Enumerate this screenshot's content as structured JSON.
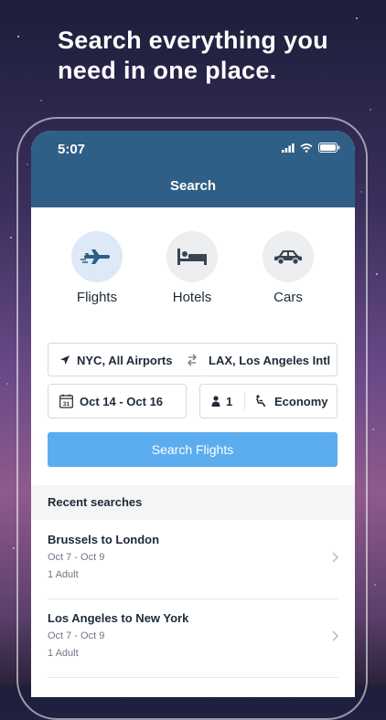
{
  "headline": "Search everything you need in one place.",
  "status": {
    "time": "5:07"
  },
  "nav": {
    "title": "Search"
  },
  "categories": [
    {
      "label": "Flights",
      "icon": "plane-icon",
      "active": true
    },
    {
      "label": "Hotels",
      "icon": "bed-icon",
      "active": false
    },
    {
      "label": "Cars",
      "icon": "car-icon",
      "active": false
    }
  ],
  "form": {
    "origin": "NYC, All Airports",
    "destination": "LAX, Los Angeles Intl",
    "dates": "Oct 14 - Oct 16",
    "travelers": "1",
    "cabin": "Economy",
    "calendar_day": "31",
    "search_button": "Search Flights"
  },
  "recent": {
    "header": "Recent searches",
    "items": [
      {
        "title": "Brussels to London",
        "dates": "Oct 7 - Oct 9",
        "passengers": "1 Adult"
      },
      {
        "title": "Los Angeles to New York",
        "dates": "Oct 7 - Oct 9",
        "passengers": "1 Adult"
      }
    ]
  },
  "colors": {
    "header": "#2f5f86",
    "button": "#5badf0",
    "icon": "#2f5f86"
  }
}
